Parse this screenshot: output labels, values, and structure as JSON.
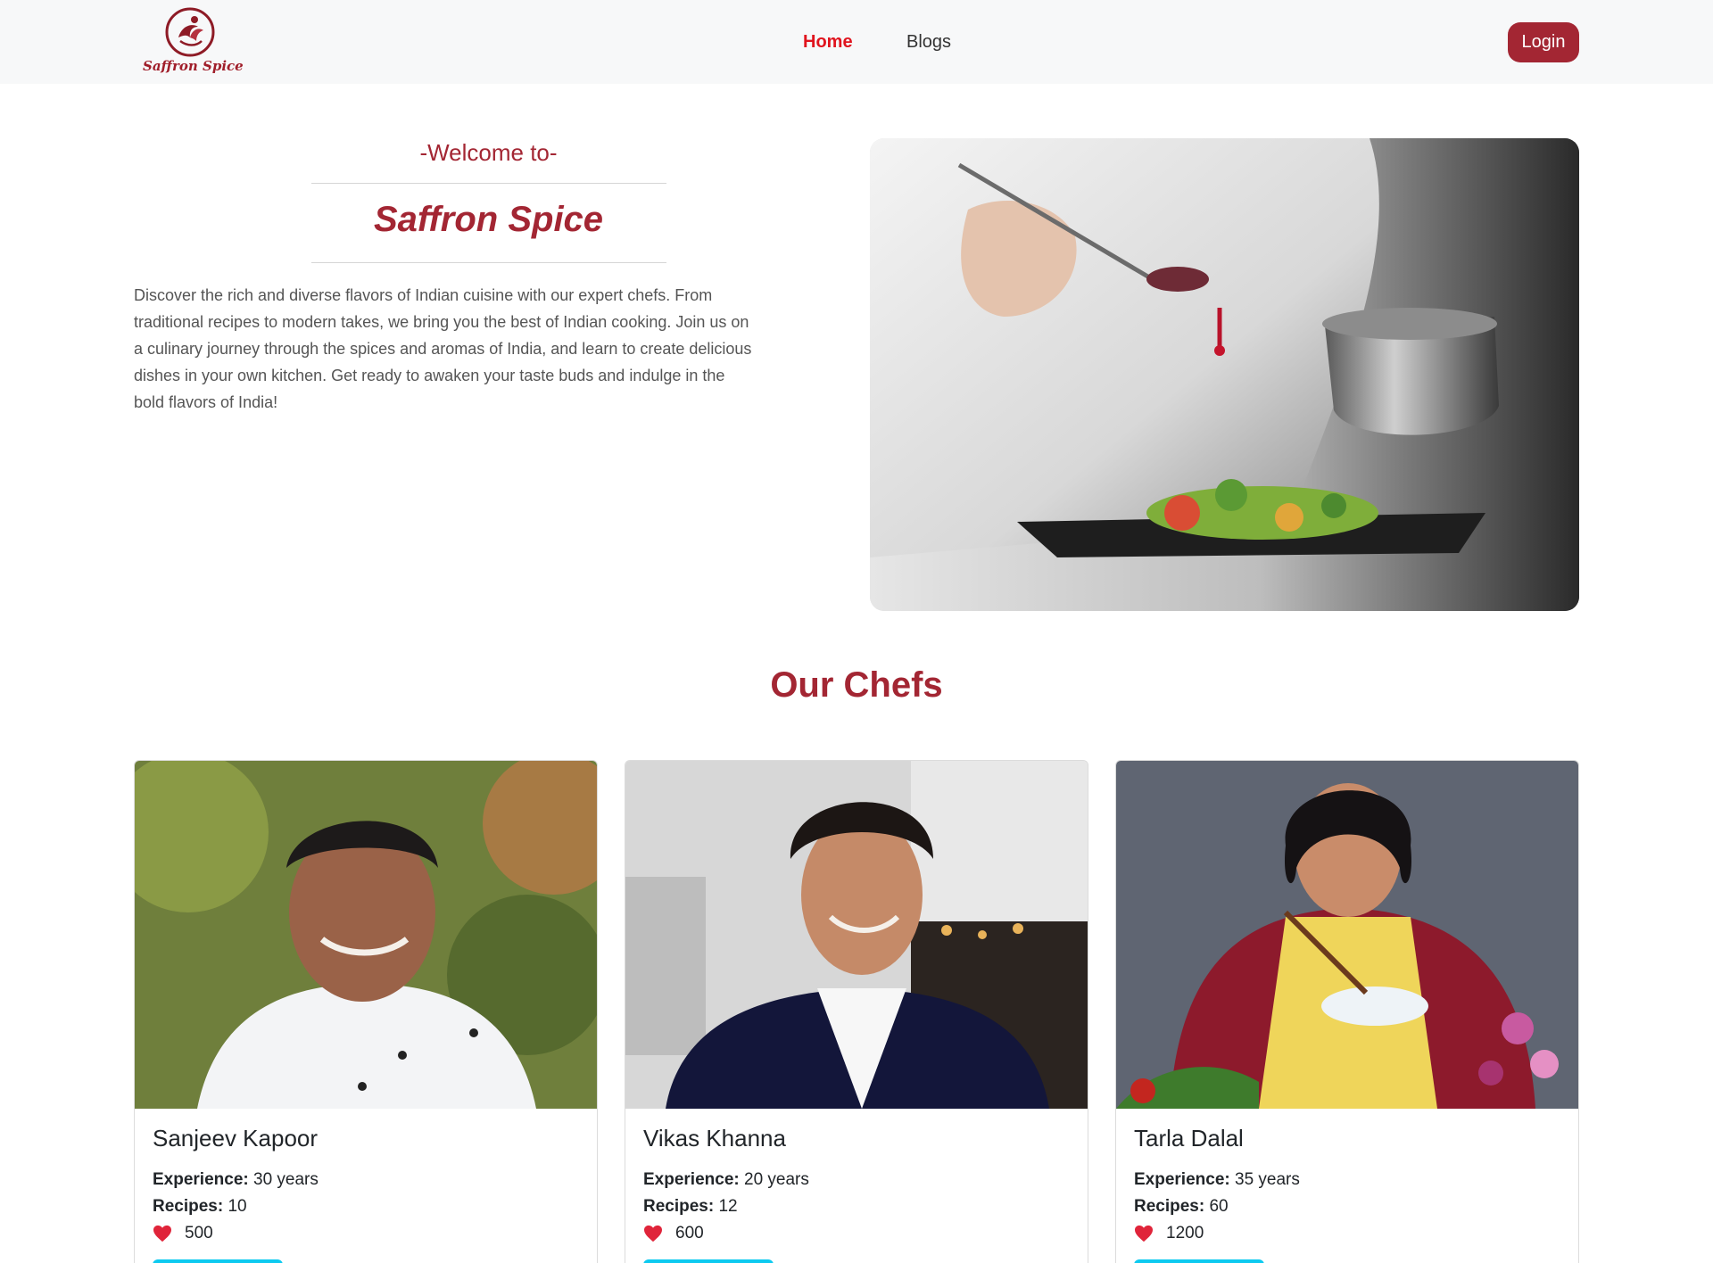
{
  "nav": {
    "logo_text": "Saffron Spice",
    "links": [
      {
        "label": "Home",
        "active": true
      },
      {
        "label": "Blogs",
        "active": false
      }
    ],
    "login_label": "Login"
  },
  "hero": {
    "welcome": "-Welcome to-",
    "title": "Saffron Spice",
    "description": "Discover the rich and diverse flavors of Indian cuisine with our expert chefs. From traditional recipes to modern takes, we bring you the best of Indian cooking. Join us on a culinary journey through the spices and aromas of India, and learn to create delicious dishes in your own kitchen. Get ready to awaken your taste buds and indulge in the bold flavors of India!"
  },
  "chefs_section": {
    "title": "Our Chefs",
    "experience_label": "Experience:",
    "recipes_label": "Recipes:",
    "chefs": [
      {
        "name": "Sanjeev Kapoor",
        "experience": "30 years",
        "recipes": "10",
        "likes": "500"
      },
      {
        "name": "Vikas Khanna",
        "experience": "20 years",
        "recipes": "12",
        "likes": "600"
      },
      {
        "name": "Tarla Dalal",
        "experience": "35 years",
        "recipes": "60",
        "likes": "1200"
      }
    ]
  },
  "colors": {
    "brand": "#a32633",
    "nav_active": "#e0141e",
    "heart": "#e0243a",
    "button_cyan": "#0dcaf0"
  },
  "icons": [
    "logo-icon",
    "heart-icon"
  ]
}
